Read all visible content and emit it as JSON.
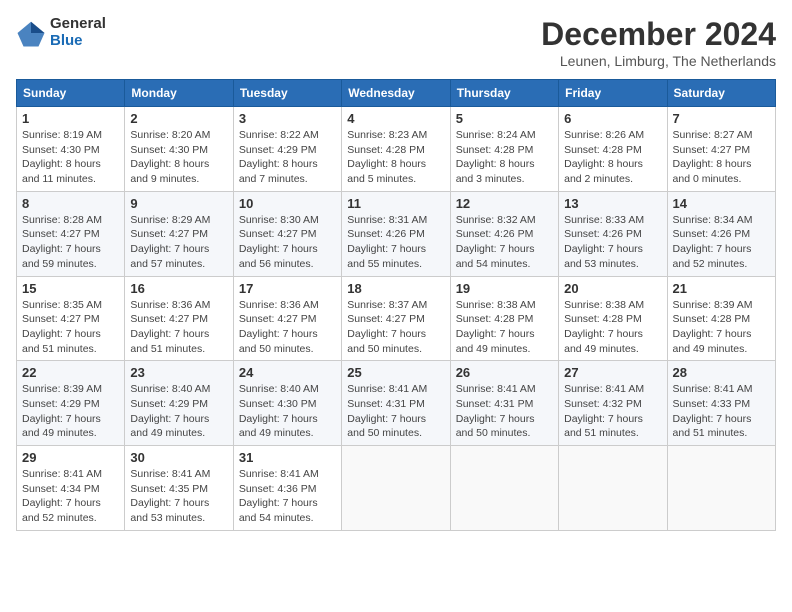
{
  "logo": {
    "general": "General",
    "blue": "Blue"
  },
  "title": "December 2024",
  "subtitle": "Leunen, Limburg, The Netherlands",
  "headers": [
    "Sunday",
    "Monday",
    "Tuesday",
    "Wednesday",
    "Thursday",
    "Friday",
    "Saturday"
  ],
  "weeks": [
    [
      {
        "day": "1",
        "sunrise": "Sunrise: 8:19 AM",
        "sunset": "Sunset: 4:30 PM",
        "daylight": "Daylight: 8 hours and 11 minutes."
      },
      {
        "day": "2",
        "sunrise": "Sunrise: 8:20 AM",
        "sunset": "Sunset: 4:30 PM",
        "daylight": "Daylight: 8 hours and 9 minutes."
      },
      {
        "day": "3",
        "sunrise": "Sunrise: 8:22 AM",
        "sunset": "Sunset: 4:29 PM",
        "daylight": "Daylight: 8 hours and 7 minutes."
      },
      {
        "day": "4",
        "sunrise": "Sunrise: 8:23 AM",
        "sunset": "Sunset: 4:28 PM",
        "daylight": "Daylight: 8 hours and 5 minutes."
      },
      {
        "day": "5",
        "sunrise": "Sunrise: 8:24 AM",
        "sunset": "Sunset: 4:28 PM",
        "daylight": "Daylight: 8 hours and 3 minutes."
      },
      {
        "day": "6",
        "sunrise": "Sunrise: 8:26 AM",
        "sunset": "Sunset: 4:28 PM",
        "daylight": "Daylight: 8 hours and 2 minutes."
      },
      {
        "day": "7",
        "sunrise": "Sunrise: 8:27 AM",
        "sunset": "Sunset: 4:27 PM",
        "daylight": "Daylight: 8 hours and 0 minutes."
      }
    ],
    [
      {
        "day": "8",
        "sunrise": "Sunrise: 8:28 AM",
        "sunset": "Sunset: 4:27 PM",
        "daylight": "Daylight: 7 hours and 59 minutes."
      },
      {
        "day": "9",
        "sunrise": "Sunrise: 8:29 AM",
        "sunset": "Sunset: 4:27 PM",
        "daylight": "Daylight: 7 hours and 57 minutes."
      },
      {
        "day": "10",
        "sunrise": "Sunrise: 8:30 AM",
        "sunset": "Sunset: 4:27 PM",
        "daylight": "Daylight: 7 hours and 56 minutes."
      },
      {
        "day": "11",
        "sunrise": "Sunrise: 8:31 AM",
        "sunset": "Sunset: 4:26 PM",
        "daylight": "Daylight: 7 hours and 55 minutes."
      },
      {
        "day": "12",
        "sunrise": "Sunrise: 8:32 AM",
        "sunset": "Sunset: 4:26 PM",
        "daylight": "Daylight: 7 hours and 54 minutes."
      },
      {
        "day": "13",
        "sunrise": "Sunrise: 8:33 AM",
        "sunset": "Sunset: 4:26 PM",
        "daylight": "Daylight: 7 hours and 53 minutes."
      },
      {
        "day": "14",
        "sunrise": "Sunrise: 8:34 AM",
        "sunset": "Sunset: 4:26 PM",
        "daylight": "Daylight: 7 hours and 52 minutes."
      }
    ],
    [
      {
        "day": "15",
        "sunrise": "Sunrise: 8:35 AM",
        "sunset": "Sunset: 4:27 PM",
        "daylight": "Daylight: 7 hours and 51 minutes."
      },
      {
        "day": "16",
        "sunrise": "Sunrise: 8:36 AM",
        "sunset": "Sunset: 4:27 PM",
        "daylight": "Daylight: 7 hours and 51 minutes."
      },
      {
        "day": "17",
        "sunrise": "Sunrise: 8:36 AM",
        "sunset": "Sunset: 4:27 PM",
        "daylight": "Daylight: 7 hours and 50 minutes."
      },
      {
        "day": "18",
        "sunrise": "Sunrise: 8:37 AM",
        "sunset": "Sunset: 4:27 PM",
        "daylight": "Daylight: 7 hours and 50 minutes."
      },
      {
        "day": "19",
        "sunrise": "Sunrise: 8:38 AM",
        "sunset": "Sunset: 4:28 PM",
        "daylight": "Daylight: 7 hours and 49 minutes."
      },
      {
        "day": "20",
        "sunrise": "Sunrise: 8:38 AM",
        "sunset": "Sunset: 4:28 PM",
        "daylight": "Daylight: 7 hours and 49 minutes."
      },
      {
        "day": "21",
        "sunrise": "Sunrise: 8:39 AM",
        "sunset": "Sunset: 4:28 PM",
        "daylight": "Daylight: 7 hours and 49 minutes."
      }
    ],
    [
      {
        "day": "22",
        "sunrise": "Sunrise: 8:39 AM",
        "sunset": "Sunset: 4:29 PM",
        "daylight": "Daylight: 7 hours and 49 minutes."
      },
      {
        "day": "23",
        "sunrise": "Sunrise: 8:40 AM",
        "sunset": "Sunset: 4:29 PM",
        "daylight": "Daylight: 7 hours and 49 minutes."
      },
      {
        "day": "24",
        "sunrise": "Sunrise: 8:40 AM",
        "sunset": "Sunset: 4:30 PM",
        "daylight": "Daylight: 7 hours and 49 minutes."
      },
      {
        "day": "25",
        "sunrise": "Sunrise: 8:41 AM",
        "sunset": "Sunset: 4:31 PM",
        "daylight": "Daylight: 7 hours and 50 minutes."
      },
      {
        "day": "26",
        "sunrise": "Sunrise: 8:41 AM",
        "sunset": "Sunset: 4:31 PM",
        "daylight": "Daylight: 7 hours and 50 minutes."
      },
      {
        "day": "27",
        "sunrise": "Sunrise: 8:41 AM",
        "sunset": "Sunset: 4:32 PM",
        "daylight": "Daylight: 7 hours and 51 minutes."
      },
      {
        "day": "28",
        "sunrise": "Sunrise: 8:41 AM",
        "sunset": "Sunset: 4:33 PM",
        "daylight": "Daylight: 7 hours and 51 minutes."
      }
    ],
    [
      {
        "day": "29",
        "sunrise": "Sunrise: 8:41 AM",
        "sunset": "Sunset: 4:34 PM",
        "daylight": "Daylight: 7 hours and 52 minutes."
      },
      {
        "day": "30",
        "sunrise": "Sunrise: 8:41 AM",
        "sunset": "Sunset: 4:35 PM",
        "daylight": "Daylight: 7 hours and 53 minutes."
      },
      {
        "day": "31",
        "sunrise": "Sunrise: 8:41 AM",
        "sunset": "Sunset: 4:36 PM",
        "daylight": "Daylight: 7 hours and 54 minutes."
      },
      null,
      null,
      null,
      null
    ]
  ]
}
